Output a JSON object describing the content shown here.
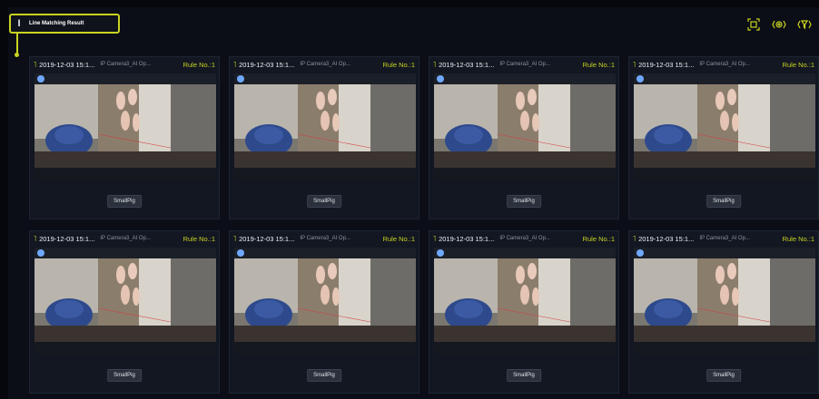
{
  "header": {
    "title": "Line Matching Result",
    "title_icon": "ibeam-icon",
    "toolbar": [
      {
        "name": "fullscreen-icon",
        "glyph": "⛶"
      },
      {
        "name": "settings-icon",
        "glyph": "⚙"
      },
      {
        "name": "filter-icon",
        "glyph": "⊽"
      }
    ]
  },
  "colors": {
    "accent": "#c9d31f",
    "bg": "#05070c",
    "card": "#121722"
  },
  "results": [
    {
      "timestamp": "2019-12-03 15:1...",
      "camera": "IP Camera3_AI Op...",
      "rule": "Rule No.:1",
      "label": "SmallPig"
    },
    {
      "timestamp": "2019-12-03 15:1...",
      "camera": "IP Camera3_AI Op...",
      "rule": "Rule No.:1",
      "label": "SmallPig"
    },
    {
      "timestamp": "2019-12-03 15:1...",
      "camera": "IP Camera3_AI Op...",
      "rule": "Rule No.:1",
      "label": "SmallPig"
    },
    {
      "timestamp": "2019-12-03 15:1...",
      "camera": "IP Camera3_AI Op...",
      "rule": "Rule No.:1",
      "label": "SmallPig"
    },
    {
      "timestamp": "2019-12-03 15:1...",
      "camera": "IP Camera3_AI Op...",
      "rule": "Rule No.:1",
      "label": "SmallPig"
    },
    {
      "timestamp": "2019-12-03 15:1...",
      "camera": "IP Camera3_AI Op...",
      "rule": "Rule No.:1",
      "label": "SmallPig"
    },
    {
      "timestamp": "2019-12-03 15:1...",
      "camera": "IP Camera3_AI Op...",
      "rule": "Rule No.:1",
      "label": "SmallPig"
    },
    {
      "timestamp": "2019-12-03 15:1...",
      "camera": "IP Camera3_AI Op...",
      "rule": "Rule No.:1",
      "label": "SmallPig"
    }
  ]
}
